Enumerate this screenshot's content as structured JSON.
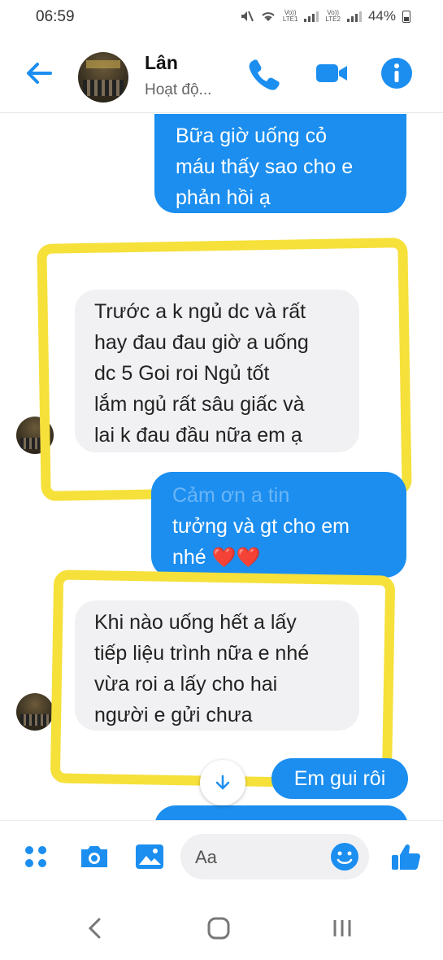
{
  "status_bar": {
    "time": "06:59",
    "sim1": "Vo))\nLTE1",
    "sim2": "Vo))\nLTE2",
    "battery": "44%"
  },
  "header": {
    "contact_name": "Lân",
    "activity_status": "Hoạt độ..."
  },
  "messages": [
    {
      "direction": "out",
      "lines": [
        "Bữa giờ uống cỏ",
        "máu thấy sao cho e",
        "phản hồi ạ"
      ]
    },
    {
      "direction": "in",
      "lines": [
        "Trước a k ngủ dc và rất",
        "hay đau đau giờ a uống",
        "dc 5 Goi roi Ngủ tốt",
        "lắm ngủ rất sâu giấc và",
        "lai k đau đầu nữa em ạ"
      ]
    },
    {
      "direction": "out",
      "lines": [
        "Cảm ơn a tin",
        "tưởng và gt cho em",
        "nhé"
      ],
      "hearts": "❤️❤️"
    },
    {
      "direction": "in",
      "lines": [
        "Khi nào uống hết a lấy",
        "tiếp liệu trình nữa e nhé",
        "vừa roi a lấy cho hai",
        "người e gửi chưa"
      ]
    },
    {
      "direction": "out",
      "lines": [
        "Em gui rôi"
      ]
    }
  ],
  "composer": {
    "placeholder": "Aa"
  },
  "colors": {
    "accent": "#1b8ef0",
    "highlight": "#f6e03a",
    "incoming_bubble": "#f1f1f3"
  },
  "icons": [
    "back-arrow-icon",
    "phone-icon",
    "video-camera-icon",
    "info-icon",
    "menu-dots-icon",
    "camera-icon",
    "gallery-icon",
    "emoji-icon",
    "thumbs-up-icon",
    "arrow-down-icon"
  ]
}
